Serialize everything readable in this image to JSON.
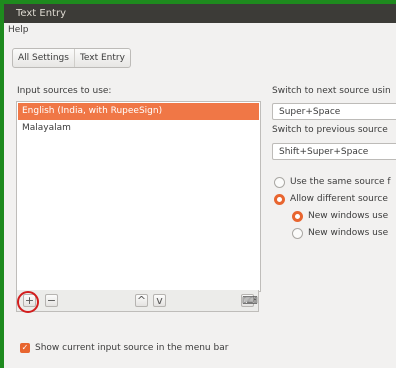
{
  "window": {
    "title": "Text Entry"
  },
  "menubar": {
    "help": "Help"
  },
  "breadcrumb": {
    "all_settings": "All Settings",
    "current": "Text Entry"
  },
  "input_sources": {
    "heading": "Input sources to use:",
    "items": [
      {
        "label": "English (India, with RupeeSign)",
        "selected": true
      },
      {
        "label": "Malayalam",
        "selected": false
      }
    ],
    "toolbar": {
      "add": "+",
      "remove": "−",
      "up": "^",
      "down": "v",
      "keyboard": "⌨"
    }
  },
  "switching": {
    "next_label": "Switch to next source usin",
    "next_value": "Super+Space",
    "prev_label": "Switch to previous source",
    "prev_value": "Shift+Super+Space",
    "same_source": "Use the same source f",
    "allow_different": "Allow different source",
    "new_windows_use_1": "New windows use",
    "new_windows_use_2": "New windows use"
  },
  "show_in_menubar": {
    "label": "Show current input source in the menu bar",
    "checked": true
  },
  "colors": {
    "accent": "#f07746",
    "titlebar": "#3c3b37",
    "highlight_circle": "#d21d1d"
  }
}
